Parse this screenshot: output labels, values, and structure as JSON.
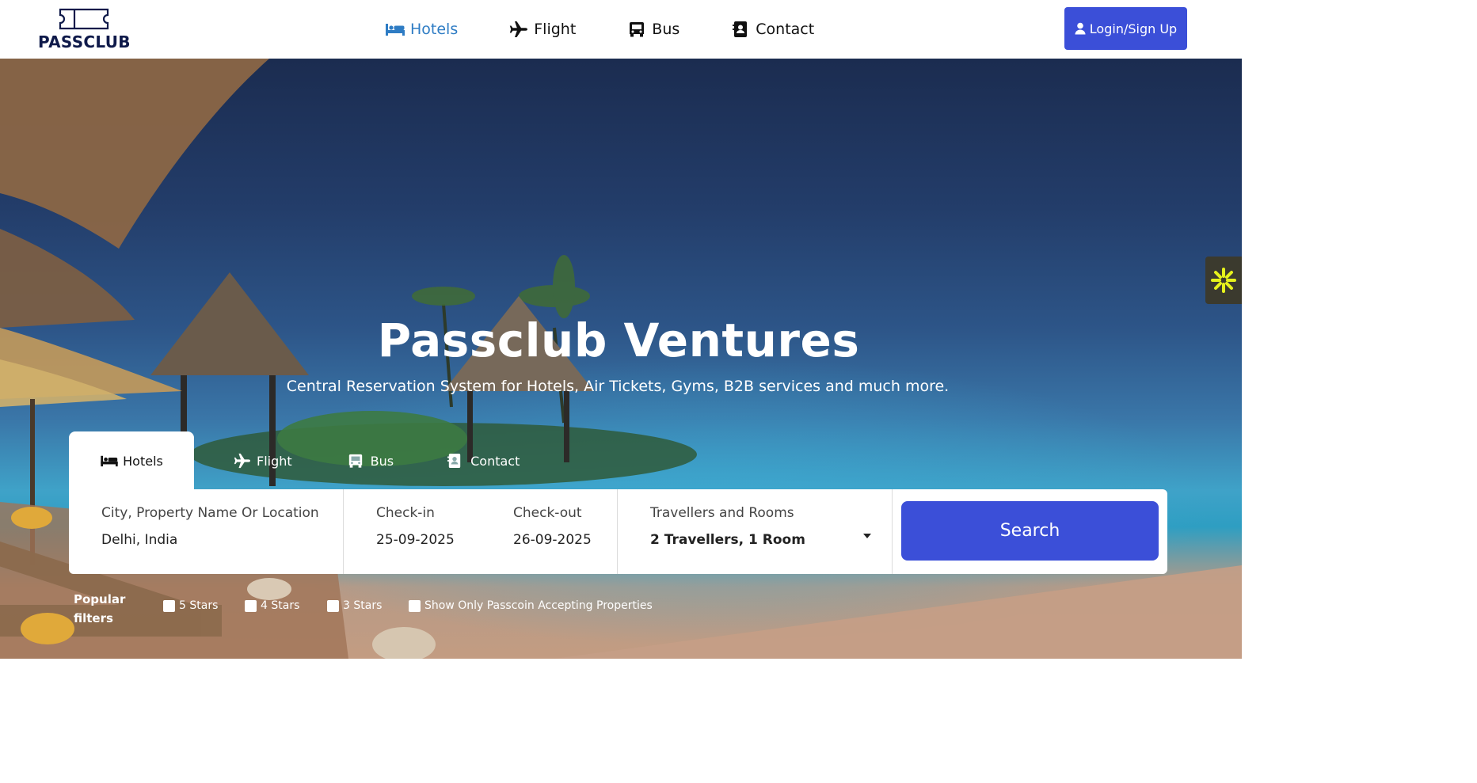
{
  "brand": {
    "name": "PASSCLUB"
  },
  "nav": {
    "items": [
      {
        "label": "Hotels",
        "icon": "bed-icon",
        "active": true
      },
      {
        "label": "Flight",
        "icon": "plane-icon",
        "active": false
      },
      {
        "label": "Bus",
        "icon": "bus-icon",
        "active": false
      },
      {
        "label": "Contact",
        "icon": "contact-book-icon",
        "active": false
      }
    ],
    "login_label": "Login/Sign Up"
  },
  "hero": {
    "title": "Passclub Ventures",
    "subtitle": "Central Reservation System for Hotels, Air Tickets, Gyms, B2B services and much more."
  },
  "search": {
    "tabs": [
      {
        "label": "Hotels",
        "icon": "bed-icon",
        "active": true
      },
      {
        "label": "Flight",
        "icon": "plane-icon",
        "active": false
      },
      {
        "label": "Bus",
        "icon": "bus-icon",
        "active": false
      },
      {
        "label": "Contact",
        "icon": "contact-book-icon",
        "active": false
      }
    ],
    "location": {
      "label": "City, Property Name Or Location",
      "value": "Delhi, India"
    },
    "checkin": {
      "label": "Check-in",
      "value": "25-09-2025"
    },
    "checkout": {
      "label": "Check-out",
      "value": "26-09-2025"
    },
    "travellers": {
      "label": "Travellers and Rooms",
      "value": "2 Travellers, 1 Room"
    },
    "button_label": "Search"
  },
  "filters": {
    "label": "Popular filters",
    "options": [
      {
        "label": "5 Stars",
        "checked": false
      },
      {
        "label": "4 Stars",
        "checked": false
      },
      {
        "label": "3 Stars",
        "checked": false
      },
      {
        "label": "Show Only Passcoin Accepting Properties",
        "checked": false
      }
    ]
  },
  "colors": {
    "primary": "#3b4fd8",
    "nav_active": "#2e7cc4",
    "brand_dark": "#0f1a4a",
    "widget_accent": "#e6f21c"
  }
}
